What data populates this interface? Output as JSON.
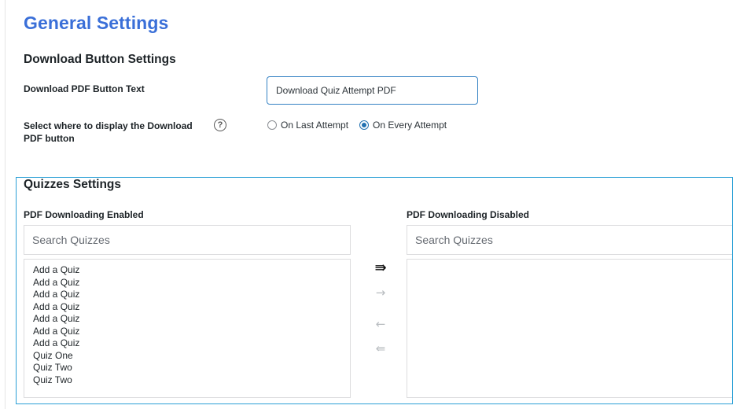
{
  "page": {
    "title": "General Settings"
  },
  "download_settings": {
    "section_title": "Download Button Settings",
    "button_text_label": "Download PDF Button Text",
    "button_text_value": "Download Quiz Attempt PDF",
    "display_label": "Select where to display the Download PDF button",
    "help_icon": "?",
    "radio_options": [
      {
        "label": "On Last Attempt",
        "checked": false
      },
      {
        "label": "On Every Attempt",
        "checked": true
      }
    ]
  },
  "quizzes_settings": {
    "section_title": "Quizzes Settings",
    "enabled": {
      "label": "PDF Downloading Enabled",
      "search_placeholder": "Search Quizzes",
      "items": [
        "Add a Quiz",
        "Add a Quiz",
        "Add a Quiz",
        "Add a Quiz",
        "Add a Quiz",
        "Add a Quiz",
        "Add a Quiz",
        "Quiz One",
        "Quiz Two",
        "Quiz Two"
      ]
    },
    "disabled": {
      "label": "PDF Downloading Disabled",
      "search_placeholder": "Search Quizzes",
      "items": []
    },
    "transfer_buttons": [
      {
        "name": "move-all-right-icon",
        "glyph": "⇛",
        "active": true
      },
      {
        "name": "move-selected-right-icon",
        "glyph": "→",
        "active": false
      },
      {
        "name": "move-selected-left-icon",
        "glyph": "←",
        "active": false
      },
      {
        "name": "move-all-left-icon",
        "glyph": "⇚",
        "active": false
      }
    ]
  },
  "colors": {
    "accent": "#3a6fd8",
    "box_border": "#2a9fd6",
    "radio": "#2271b1"
  }
}
